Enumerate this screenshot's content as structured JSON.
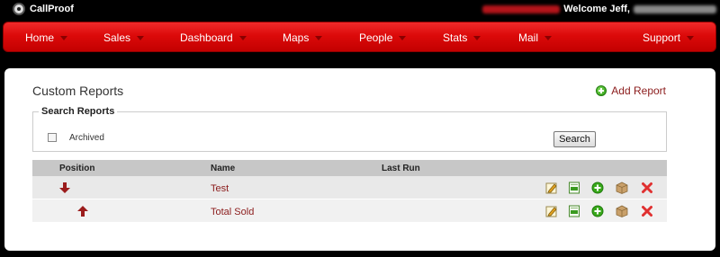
{
  "app": {
    "name": "CallProof",
    "welcome": "Welcome Jeff,"
  },
  "nav": {
    "items": [
      {
        "label": "Home"
      },
      {
        "label": "Sales"
      },
      {
        "label": "Dashboard"
      },
      {
        "label": "Maps"
      },
      {
        "label": "People"
      },
      {
        "label": "Stats"
      },
      {
        "label": "Mail"
      },
      {
        "label": "Support"
      }
    ]
  },
  "page": {
    "title": "Custom Reports",
    "add_label": "Add Report"
  },
  "search": {
    "legend": "Search Reports",
    "archived_label": "Archived",
    "archived_checked": false,
    "button_label": "Search"
  },
  "table": {
    "headers": {
      "position": "Position",
      "name": "Name",
      "last_run": "Last Run"
    },
    "rows": [
      {
        "name": "Test",
        "last_run": "",
        "move": "down"
      },
      {
        "name": "Total Sold",
        "last_run": "",
        "move": "up"
      }
    ]
  },
  "colors": {
    "nav_red": "#dc0a0a",
    "link_red": "#8b1b1b",
    "delete_red": "#e03030",
    "add_green": "#2b9a12"
  },
  "icons": {
    "row_actions": [
      "edit-icon",
      "csv-export-icon",
      "add-icon",
      "archive-box-icon",
      "delete-icon"
    ]
  }
}
